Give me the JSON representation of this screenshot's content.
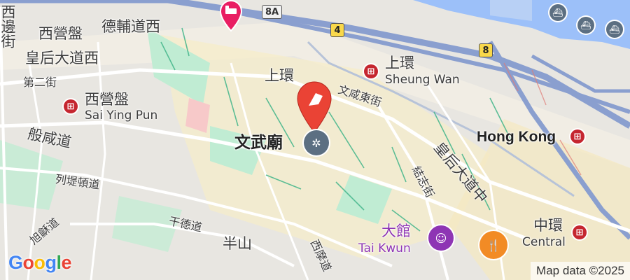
{
  "map": {
    "labels": {
      "sai_ying_pun_district": "西營盤",
      "des_voeux_rd_west": "德輔道西",
      "queens_rd_west": "皇后大道西",
      "second_street": "第二街",
      "sai_ying_pun_station_zh": "西營盤",
      "sai_ying_pun_station_en": "Sai Ying Pun",
      "poon_shin_road": "般咸道",
      "lyttelton_road": "列堤頓道",
      "conduit_road_short": "干德道",
      "mid_levels": "半山",
      "park_road_vertical": "旭龢道",
      "robinson_road_vertical": "西摩道",
      "western_district_vertical": "西邊街",
      "sheung_wan_district": "上環",
      "man_mo_temple": "文武廟",
      "bonham_strand_east": "文咸東街",
      "sheung_wan_station_zh": "上環",
      "sheung_wan_station_en": "Sheung Wan",
      "hong_kong_station": "Hong Kong",
      "queens_rd_central": "皇后大道中",
      "gilman_street": "結志街",
      "tai_kwun_zh": "大館",
      "tai_kwun_en": "Tai Kwun",
      "central_zh": "中環",
      "central_en": "Central"
    },
    "shields": {
      "route_8a": "8A",
      "route_4": "4",
      "route_8": "8"
    },
    "mtr_symbol": "⊞",
    "icons": {
      "hotel": "hotel-icon",
      "selected_pin": "pin-icon",
      "temple": "temple-icon",
      "museum": "museum-icon",
      "restaurant": "restaurant-icon",
      "ferry": "ferry-icon"
    },
    "logo": "Google",
    "attribution": "Map data ©2025",
    "colors": {
      "water": "#9cc0f9",
      "park": "#c0ecd3",
      "highway": "#8a9fcf",
      "arterial": "#ffffff",
      "selected_pin": "#ea4335",
      "mtr": "#c5262f",
      "tai_kwun": "#8e35b4",
      "restaurant": "#f28b25",
      "hotel": "#e91e63"
    }
  }
}
